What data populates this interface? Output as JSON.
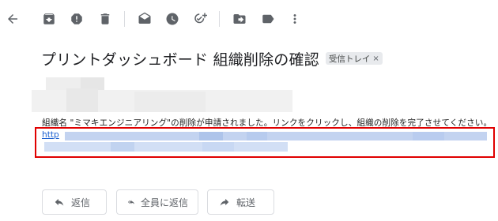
{
  "toolbar": {
    "icons": [
      "back-icon",
      "archive-icon",
      "report-spam-icon",
      "delete-icon",
      "mark-unread-icon",
      "snooze-icon",
      "add-task-icon",
      "move-to-icon",
      "label-icon",
      "more-icon"
    ]
  },
  "email": {
    "subject": "プリントダッシュボード 組織削除の確認",
    "label_chip": "受信トレイ",
    "label_chip_close": "×",
    "body_line": "組織名 \"ミマキエンジニアリング\"の削除が申請されました。リンクをクリックし、組織の削除を完了させてください。",
    "link_prefix": "http"
  },
  "actions": {
    "reply": "返信",
    "reply_all": "全員に返信",
    "forward": "転送"
  },
  "colors": {
    "highlight_border": "#e00000",
    "link": "#1a5fd0",
    "redacted_link": "#c3d3f0"
  }
}
